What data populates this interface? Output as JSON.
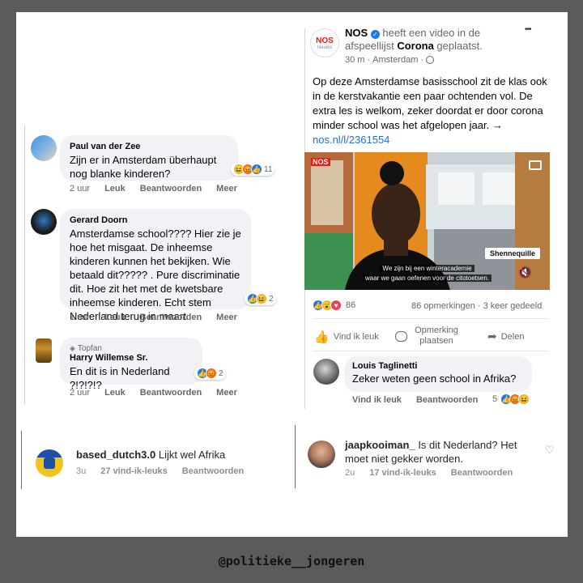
{
  "left_comments": [
    {
      "name": "Paul van der Zee",
      "text": "Zijn er in Amsterdam überhaupt\nnog blanke kinderen?",
      "time": "2 uur",
      "like": "Leuk",
      "reply": "Beantwoorden",
      "more": "Meer",
      "reaction_count": "11"
    },
    {
      "name": "Gerard Doorn",
      "text": "Amsterdamse school???? Hier zie je\nhoe het misgaat. De inheemse\nkinderen kunnen het bekijken. Wie\nbetaald dit?????  . Pure discriminatie\ndit. Hoe zit het met de kwetsbare\ninheemse kinderen. Echt stem\nNederland terug in maart.",
      "time": "1 uur",
      "like": "Leuk",
      "reply": "Beantwoorden",
      "more": "Meer",
      "reaction_count": "2"
    },
    {
      "badge": "Topfan",
      "name": "Harry Willemse Sr.",
      "text": "En dit is in Nederland ?!?!?!?",
      "time": "2 uur",
      "like": "Leuk",
      "reply": "Beantwoorden",
      "more": "Meer",
      "reaction_count": "2"
    }
  ],
  "post": {
    "logo": "NOS",
    "logo_sub": "nieuws",
    "author": "NOS",
    "action_pre": " heeft een video in de afspeellijst ",
    "playlist": "Corona",
    "action_post": " geplaatst.",
    "time": "30 m",
    "location": "Amsterdam",
    "body": "Op deze Amsterdamse basisschool zit de klas ook in de kerstvakantie een paar ochtenden vol. De extra les is welkom, zeker doordat er door corona minder school was het afgelopen jaar. → ",
    "link": "nos.nl/l/2361554",
    "video_brand": "NOS",
    "video_name_tag": "Shennequille",
    "subtitle_1": "We zijn bij een winteracademie",
    "subtitle_2": "waar we gaan oefenen voor de citotoetsen.",
    "reaction_count": "86",
    "comments_count": "86 opmerkingen",
    "shares_count": "3 keer gedeeld",
    "btn_like": "Vind ik leuk",
    "btn_comment": "Opmerking plaatsen",
    "btn_share": "Delen",
    "more": "•••"
  },
  "post_comment": {
    "name": "Louis Taglinetti",
    "text": "Zeker weten geen school in Afrika?",
    "like": "Vind ik leuk",
    "reply": "Beantwoorden",
    "reaction_count": "5"
  },
  "ig_left": {
    "username": "based_dutch3.0",
    "text": " Lijkt wel Afrika",
    "time": "3u",
    "likes": "27 vind-ik-leuks",
    "reply": "Beantwoorden"
  },
  "ig_right": {
    "username": "jaapkooiman_",
    "text": " Is dit Nederland? Het moet niet gekker worden.",
    "time": "2u",
    "likes": "17 vind-ik-leuks",
    "reply": "Beantwoorden"
  },
  "watermark": "@politieke__jongeren"
}
